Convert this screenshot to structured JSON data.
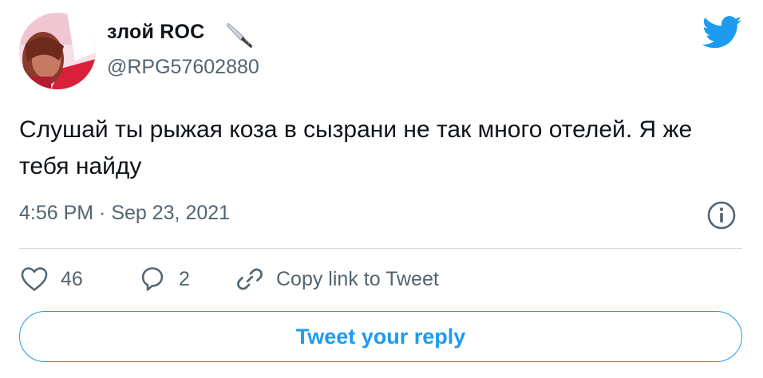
{
  "tweet": {
    "author": {
      "display_name": "злой ROC",
      "name_emoji": "kitchen-knife-emoji",
      "handle": "@RPG57602880"
    },
    "text": "Слушай ты рыжая коза в сызрани не так много отелей. Я же тебя найду",
    "timestamp": "4:56 PM · Sep 23, 2021",
    "actions": {
      "like_count": "46",
      "reply_count": "2",
      "copy_link_label": "Copy link to Tweet"
    },
    "reply_button_label": "Tweet your reply"
  },
  "icons": {
    "brand": "twitter-bird-icon",
    "info": "info-icon",
    "like": "heart-icon",
    "reply": "speech-bubble-icon",
    "copy_link": "link-icon"
  },
  "colors": {
    "accent": "#1d9bf0",
    "text_primary": "#0f1419",
    "text_secondary": "#536471",
    "divider": "#cfd9de"
  }
}
